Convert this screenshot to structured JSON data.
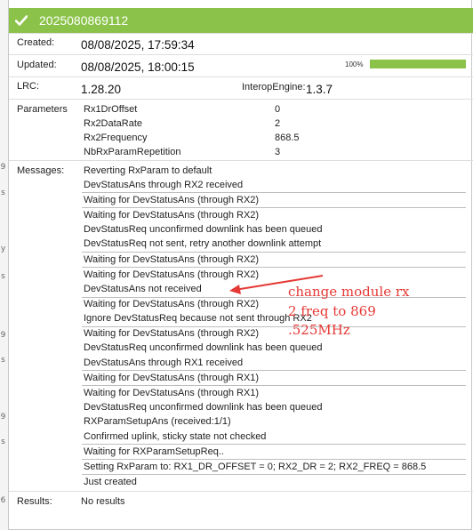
{
  "header": {
    "title": "2025080869112",
    "accent": "#8bc34a"
  },
  "fields": {
    "created_label": "Created:",
    "created_value": "08/08/2025, 17:59:34",
    "updated_label": "Updated:",
    "updated_value": "08/08/2025, 18:00:15",
    "progress_label": "100%",
    "progress_fraction": 1.0,
    "lrc_label": "LRC:",
    "lrc_value": "1.28.20",
    "interop_label": "InteropEngine:",
    "interop_value": "1.3.7"
  },
  "parameters": {
    "label": "Parameters",
    "items": [
      {
        "name": "Rx1DrOffset",
        "value": "0"
      },
      {
        "name": "Rx2DataRate",
        "value": "2"
      },
      {
        "name": "Rx2Frequency",
        "value": "868.5"
      },
      {
        "name": "NbRxParamRepetition",
        "value": "3"
      }
    ]
  },
  "messages": {
    "label": "Messages:",
    "items": [
      "Reverting RxParam to default",
      "DevStatusAns through RX2 received",
      "Waiting for DevStatusAns (through RX2)",
      "Waiting for DevStatusAns (through RX2)",
      "DevStatusReq unconfirmed downlink has been queued",
      "DevStatusReq not sent, retry another downlink attempt",
      "Waiting for DevStatusAns (through RX2)",
      "Waiting for DevStatusAns (through RX2)",
      "DevStatusAns not received",
      "Waiting for DevStatusAns (through RX2)",
      "Ignore DevStatusReq because not sent through RX2",
      "Waiting for DevStatusAns (through RX2)",
      "DevStatusReq unconfirmed downlink has been queued",
      "DevStatusAns through RX1 received",
      "Waiting for DevStatusAns (through RX1)",
      "Waiting for DevStatusAns (through RX1)",
      "DevStatusReq unconfirmed downlink has been queued",
      "RXParamSetupAns (received:1/1)",
      "Confirmed uplink, sticky state not checked",
      "Waiting for RXParamSetupReq..",
      "Setting RxParam to: RX1_DR_OFFSET = 0; RX2_DR = 2; RX2_FREQ = 868.5",
      "Just created"
    ]
  },
  "annotation": {
    "lines": [
      "change module rx",
      "2 freq to 869",
      ".525MHz"
    ],
    "color": "#e53935"
  },
  "results": {
    "label": "Results:",
    "value": "No results"
  },
  "left_strip_marks": [
    "9",
    "s",
    "y",
    "s",
    "9",
    "s",
    "9",
    "s",
    "6"
  ]
}
